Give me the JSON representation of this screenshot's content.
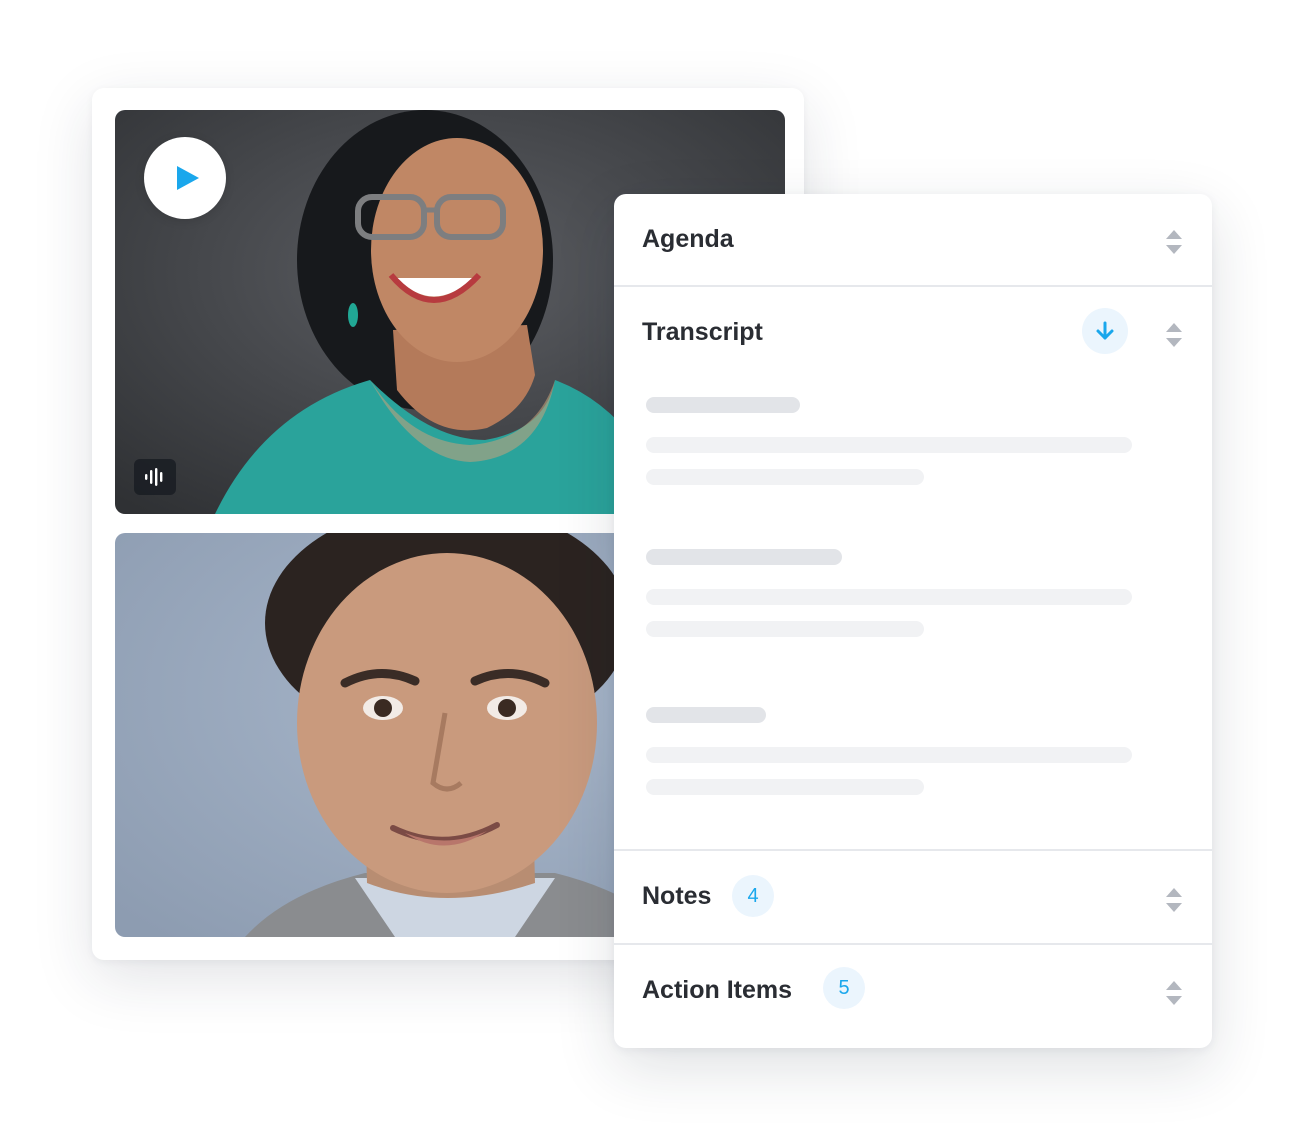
{
  "colors": {
    "accent": "#1aa7ec",
    "badge_bg": "#ebf5fd",
    "divider": "#e6e8ec",
    "skeleton_heading": "#e2e4e8",
    "skeleton_line": "#f1f2f4",
    "sort_arrow": "#b3b7bf"
  },
  "video": {
    "play_icon": "play-icon",
    "audio_icon": "audio-waveform-icon",
    "participants": [
      {
        "tile": "top",
        "description_icon": "participant-video"
      },
      {
        "tile": "bottom",
        "description_icon": "participant-video"
      }
    ]
  },
  "panel": {
    "sections": {
      "agenda": {
        "title": "Agenda",
        "icon": "sort-arrows-icon"
      },
      "transcript": {
        "title": "Transcript",
        "action_icon": "download-arrow-icon",
        "icon": "sort-arrows-icon"
      },
      "notes": {
        "title": "Notes",
        "count": "4",
        "icon": "sort-arrows-icon"
      },
      "action_items": {
        "title": "Action Items",
        "count": "5",
        "icon": "sort-arrows-icon"
      }
    }
  }
}
